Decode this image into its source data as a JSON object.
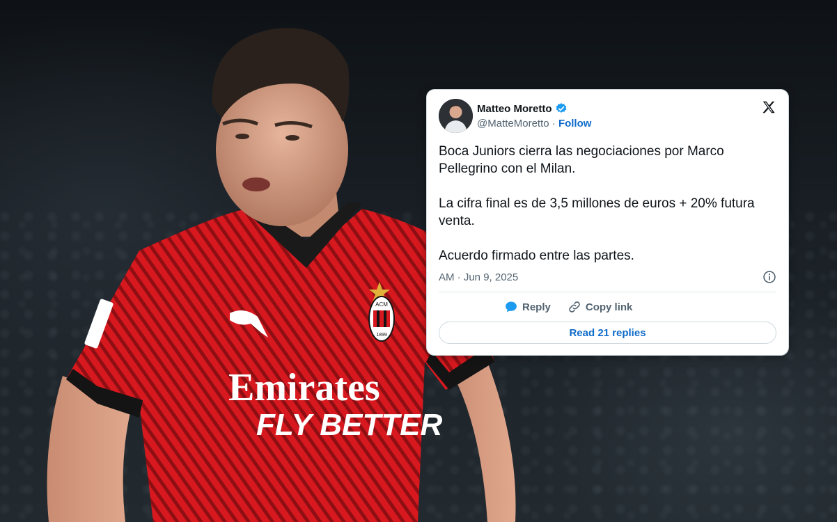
{
  "tweet": {
    "author_name": "Matteo Moretto",
    "author_handle": "@MatteMoretto",
    "separator": "·",
    "follow_label": "Follow",
    "paragraphs": [
      "Boca Juniors cierra las negociaciones por Marco Pellegrino con el Milan.",
      "La cifra final es de 3,5 millones de euros + 20% futura venta.",
      "Acuerdo firmado entre las partes."
    ],
    "time": "AM",
    "date": "Jun 9, 2025",
    "reply_label": "Reply",
    "copy_link_label": "Copy link",
    "read_replies_label": "Read 21 replies"
  },
  "shirt": {
    "sponsor_line1": "Emirates",
    "sponsor_line2": "FLY BETTER",
    "crest_text": "ACM",
    "crest_year": "1899"
  },
  "colors": {
    "shirt_red": "#d7191f",
    "shirt_black": "#141414",
    "link_blue": "#0f6bc9",
    "verified_blue": "#1d9bf0"
  },
  "icons": {
    "verified": "verified-badge-icon",
    "brand": "x-logo-icon",
    "info": "info-icon",
    "reply": "reply-icon",
    "copy_link": "link-icon"
  }
}
